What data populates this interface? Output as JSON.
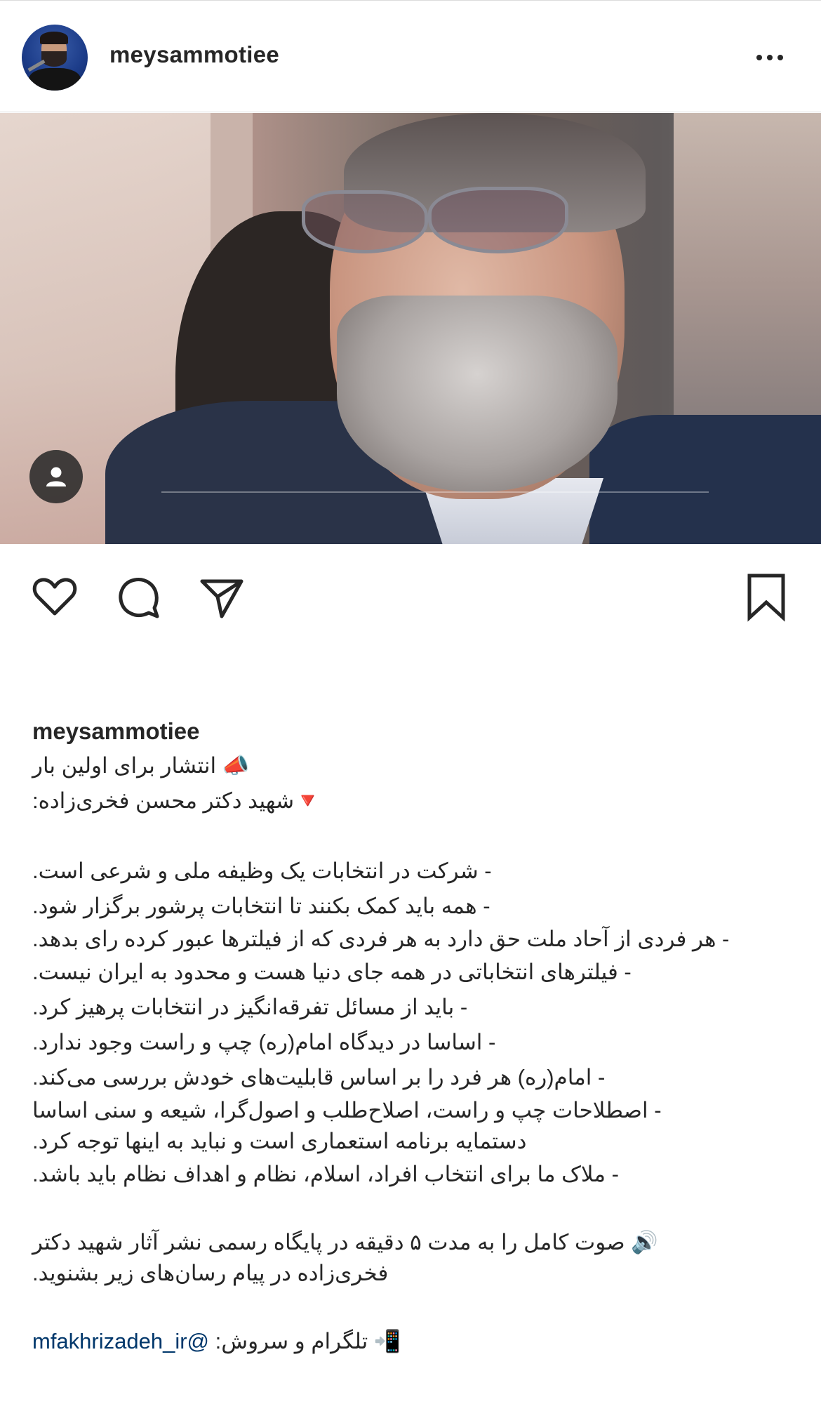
{
  "header": {
    "username": "meysammotiee",
    "avatar_icon": "profile-avatar",
    "more_icon": "more-horizontal-icon"
  },
  "post": {
    "user_tag_icon": "person-tag-icon",
    "actions": {
      "like_icon": "heart-icon",
      "comment_icon": "comment-icon",
      "share_icon": "send-icon",
      "save_icon": "bookmark-icon"
    }
  },
  "caption": {
    "username": "meysammotiee",
    "lines": [
      "📣 انتشار برای اولین بار",
      "🔻شهید دکتر محسن فخری‌زاده:",
      "",
      "- شرکت در انتخابات یک وظیفه ملی و شرعی است.",
      "- همه باید کمک بکنند تا انتخابات پرشور برگزار شود.",
      "- هر فردی از آحاد ملت حق دارد به هر فردی که از فیلترها عبور کرده رای بدهد.",
      "- فیلترهای انتخاباتی در همه جای دنیا هست و  محدود به ایران نیست.",
      "- باید از مسائل تفرقه‌انگیز در انتخابات پرهیز کرد.",
      "- اساسا در دیدگاه امام(ره) چپ و راست وجود ندارد.",
      "- امام(ره) هر فرد را بر اساس قابلیت‌های خودش بررسی می‌کند.",
      "- اصطلاحات چپ و راست، اصلاح‌طلب و اصول‌گرا، شیعه و سنی اساسا دستمایه برنامه استعماری است و نباید به اینها توجه کرد.",
      "- ملاک ما برای انتخاب افراد، اسلام، نظام و اهداف نظام باید باشد.",
      "",
      "🔊 صوت کامل را به مدت ۵ دقیقه در پایگاه رسمی نشر آثار شهید دکتر فخری‌زاده در پیام رسان‌های زیر بشنوید.",
      ""
    ],
    "last_line_prefix": "📲 تلگرام و سروش: ",
    "last_line_link": "@mfakhrizadeh_ir"
  }
}
